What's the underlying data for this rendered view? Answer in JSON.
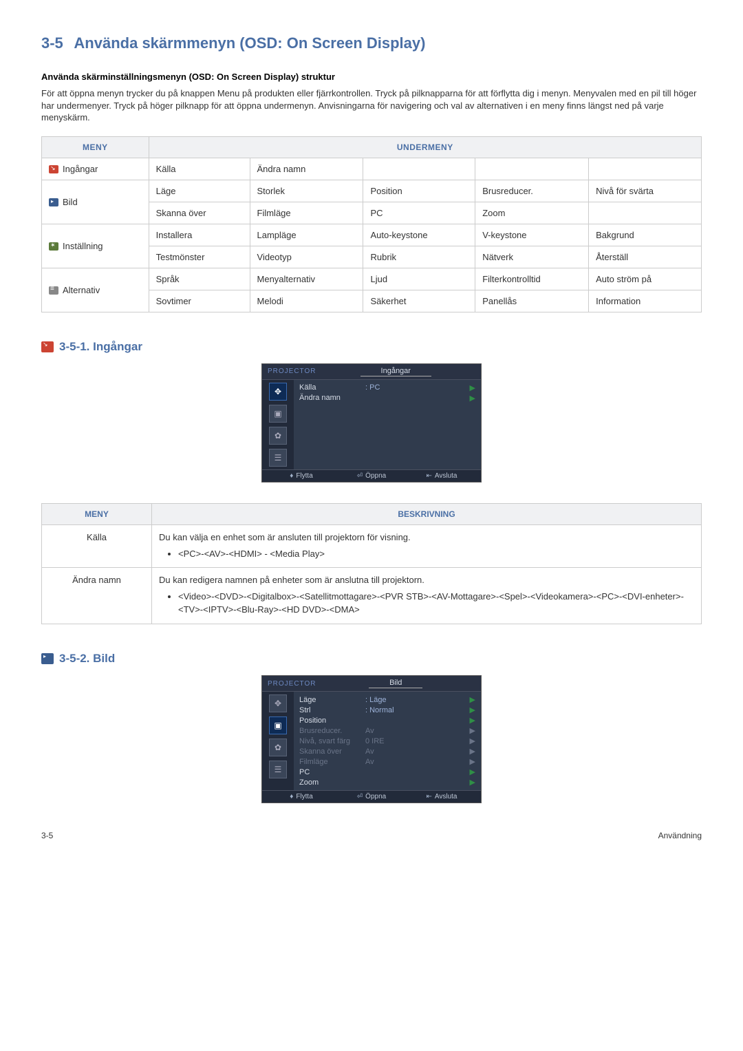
{
  "header": {
    "section_number": "3-5",
    "section_title": "Använda skärmmenyn (OSD: On Screen Display)"
  },
  "intro": {
    "subheading": "Använda skärminställningsmenyn (OSD: On Screen Display) struktur",
    "paragraph": "För att öppna menyn trycker du på knappen Menu på produkten eller fjärrkontrollen. Tryck på pilknapparna för att förflytta dig i menyn. Menyvalen med en pil till höger har undermenyer. Tryck på höger pilknapp för att öppna undermenyn. Anvisningarna för navigering och val av alternativen i en meny finns längst ned på varje menyskärm."
  },
  "menu_table": {
    "header_menu": "MENY",
    "header_sub": "UNDERMENY",
    "rows": [
      {
        "label": "Ingångar",
        "cells": [
          [
            "Källa",
            "Ändra namn",
            "",
            "",
            ""
          ]
        ]
      },
      {
        "label": "Bild",
        "cells": [
          [
            "Läge",
            "Storlek",
            "Position",
            "Brusreducer.",
            "Nivå för svärta"
          ],
          [
            "Skanna över",
            "Filmläge",
            "PC",
            "Zoom",
            ""
          ]
        ]
      },
      {
        "label": "Inställning",
        "cells": [
          [
            "Installera",
            "Lampläge",
            "Auto-keystone",
            "V-keystone",
            "Bakgrund"
          ],
          [
            "Testmönster",
            "Videotyp",
            "Rubrik",
            "Nätverk",
            "Återställ"
          ]
        ]
      },
      {
        "label": "Alternativ",
        "cells": [
          [
            "Språk",
            "Menyalternativ",
            "Ljud",
            "Filterkontrolltid",
            "Auto ström på"
          ],
          [
            "Sovtimer",
            "Melodi",
            "Säkerhet",
            "Panellås",
            "Information"
          ]
        ]
      }
    ]
  },
  "sec1": {
    "number": "3-5-1.",
    "title": "Ingångar"
  },
  "osd1": {
    "projector": "PROJECTOR",
    "title": "Ingångar",
    "rows": [
      {
        "lbl": "Källa",
        "val": ": PC"
      },
      {
        "lbl": "Ändra namn",
        "val": ""
      }
    ],
    "footer": {
      "move": "Flytta",
      "open": "Öppna",
      "exit": "Avsluta"
    }
  },
  "desc_table": {
    "header_menu": "MENY",
    "header_desc": "BESKRIVNING",
    "rows": [
      {
        "menu": "Källa",
        "line1": "Du kan välja en enhet som är ansluten till projektorn för visning.",
        "bullet": "<PC>-<AV>-<HDMI> - <Media Play>"
      },
      {
        "menu": "Ändra namn",
        "line1": "Du kan redigera namnen på enheter som är anslutna till projektorn.",
        "bullet": "<Video>-<DVD>-<Digitalbox>-<Satellitmottagare>-<PVR STB>-<AV-Mottagare>-<Spel>-<Videokamera>-<PC>-<DVI-enheter>-<TV>-<IPTV>-<Blu-Ray>-<HD DVD>-<DMA>"
      }
    ]
  },
  "sec2": {
    "number": "3-5-2.",
    "title": "Bild"
  },
  "osd2": {
    "projector": "PROJECTOR",
    "title": "Bild",
    "rows": [
      {
        "lbl": "Läge",
        "val": ": Läge",
        "dim": false
      },
      {
        "lbl": "Strl",
        "val": ": Normal",
        "dim": false
      },
      {
        "lbl": "Position",
        "val": "",
        "dim": false
      },
      {
        "lbl": "Brusreducer.",
        "val": "Av",
        "dim": true
      },
      {
        "lbl": "Nivå, svart färg",
        "val": "0 IRE",
        "dim": true
      },
      {
        "lbl": "Skanna över",
        "val": "Av",
        "dim": true
      },
      {
        "lbl": "Filmläge",
        "val": "Av",
        "dim": true
      },
      {
        "lbl": "PC",
        "val": "",
        "dim": false
      },
      {
        "lbl": "Zoom",
        "val": "",
        "dim": false
      }
    ],
    "footer": {
      "move": "Flytta",
      "open": "Öppna",
      "exit": "Avsluta"
    }
  },
  "footer": {
    "left": "3-5",
    "right": "Användning"
  }
}
